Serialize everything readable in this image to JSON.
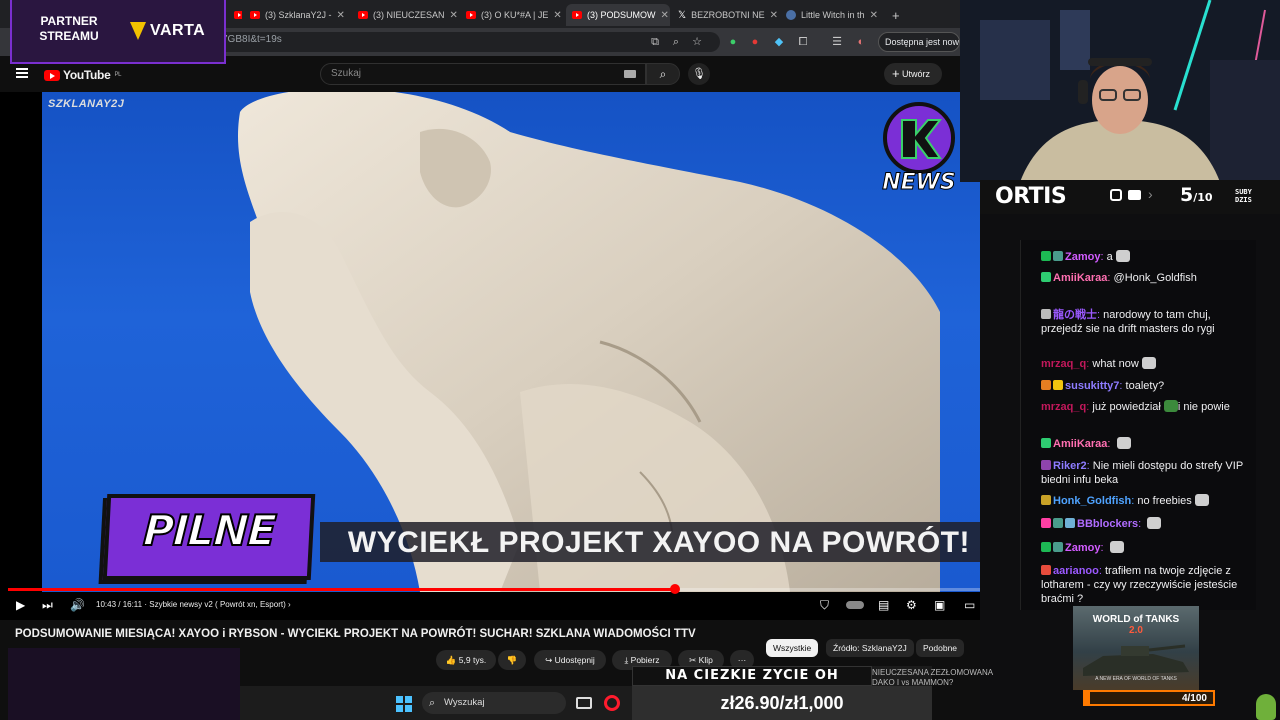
{
  "browser": {
    "tabs": [
      {
        "label": "",
        "active": false
      },
      {
        "label": "(3) SzklanaY2J -",
        "active": false
      },
      {
        "label": "(3) NIEUCZESAN",
        "active": false
      },
      {
        "label": "(3) O KU*#A | JE",
        "active": false
      },
      {
        "label": "(3) PODSUMOW",
        "active": true
      },
      {
        "label": "BEZROBOTNI NE",
        "active": false
      },
      {
        "label": "Little Witch in th",
        "active": false
      }
    ],
    "url_fragment": "7GB8I&t=19s",
    "update_label": "Dostępna jest nowa w"
  },
  "youtube": {
    "logo": "YouTube",
    "logo_region": "PL",
    "search_placeholder": "Szukaj",
    "create_label": "Utwórz",
    "video": {
      "watermark": "SZKLANAY2J",
      "logo_text": "NEWS",
      "tag": "PILNE",
      "headline": "WYCIEKŁ PROJEKT XAYOO NA POWRÓT!",
      "progress_fraction": 0.686,
      "time": "10:43 / 16:11",
      "chapter": "· Szybkie newsy v2 ( Powrót xn, Esport)",
      "chapter_arrow": "›"
    },
    "title": "PODSUMOWANIE MIESIĄCA! XAYOO i RYBSON - WYCIEKŁ PROJEKT NA POWRÓT! SUCHAR! SZKLANA WIADOMOŚCI TTV",
    "actions": {
      "likes": "5,9 tys.",
      "share": "Udostępnij",
      "download": "Pobierz",
      "clip": "Klip",
      "more": "···"
    },
    "chips": [
      "Wszystkie",
      "Źródło: SzklanaY2J",
      "Podobne"
    ]
  },
  "overlay": {
    "partner_line1": "PARTNER",
    "partner_line2": "STREAMU",
    "sponsor": "VARTA",
    "streamer": "ORTIS",
    "subs_count": "5",
    "subs_goal": "/10",
    "subs_label_1": "SUBY",
    "subs_label_2": "DZIS",
    "goal_text": "4/100",
    "goal_fraction": 0.04,
    "ticker_top": "NA CIEZKIE ZYCIE OH",
    "ticker_main": "zł26.90/zł1,000",
    "ticker_side_1": "NIEUCZESANA ZEZŁOMOWANA",
    "ticker_side_2": "DAKO I  vs MAMMON?",
    "wot_title_1": "WORLD of TANKS",
    "wot_title_2": "2.0",
    "wot_sub": "A NEW ERA OF WORLD OF TANKS"
  },
  "chat": [
    {
      "nick": "Zamoy",
      "nick_color": "#d25cff",
      "text": "a",
      "badges": [
        "#1db954",
        "#4a9c8c"
      ]
    },
    {
      "nick": "AmiiKaraa",
      "nick_color": "#ff6fb1",
      "text": "@Honk_Goldfish",
      "badges": [
        "#2ecc71"
      ]
    },
    {
      "nick": "龍の戦士",
      "nick_color": "#9b59ff",
      "text": "narodowy to tam chuj, przejedź sie na drift masters do rygi",
      "badges": [
        "#bbbbbb"
      ]
    },
    {
      "nick": "mrzaq_q",
      "nick_color": "#c2185b",
      "text": "what now",
      "badges": []
    },
    {
      "nick": "susukitty7",
      "nick_color": "#8e7cff",
      "text": "toalety?",
      "badges": [
        "#e67e22",
        "#f1c40f"
      ]
    },
    {
      "nick": "mrzaq_q",
      "nick_color": "#c2185b",
      "text": "już powiedział",
      "text2": "i nie powie",
      "badges": []
    },
    {
      "nick": "AmiiKaraa",
      "nick_color": "#ff6fb1",
      "text": "",
      "badges": [
        "#2ecc71"
      ]
    },
    {
      "nick": "Riker2",
      "nick_color": "#8e7cff",
      "text": "Nie mieli dostępu do strefy VIP biedni infu beka",
      "badges": [
        "#8e44ad"
      ]
    },
    {
      "nick": "Honk_Goldfish",
      "nick_color": "#4fa3ff",
      "text": "no freebies",
      "badges": [
        "#c9a227"
      ]
    },
    {
      "nick": "BBblockers",
      "nick_color": "#b06cff",
      "text": "",
      "badges": [
        "#ff3fa4",
        "#4a9c8c",
        "#6fb1d6"
      ]
    },
    {
      "nick": "Zamoy",
      "nick_color": "#d25cff",
      "text": "",
      "badges": [
        "#1db954",
        "#4a9c8c"
      ]
    },
    {
      "nick": "aarianoo",
      "nick_color": "#9b59ff",
      "text": "trafiłem na twoje zdjęcie z lotharem - czy wy rzeczywiście jesteście braćmi ?",
      "badges": [
        "#e74c3c"
      ]
    }
  ],
  "taskbar": {
    "search_label": "Wyszukaj"
  },
  "colors": {
    "youtube_red": "#ff0000",
    "purple_accent": "#7b2fd6",
    "goal_orange": "#ff7a00"
  }
}
